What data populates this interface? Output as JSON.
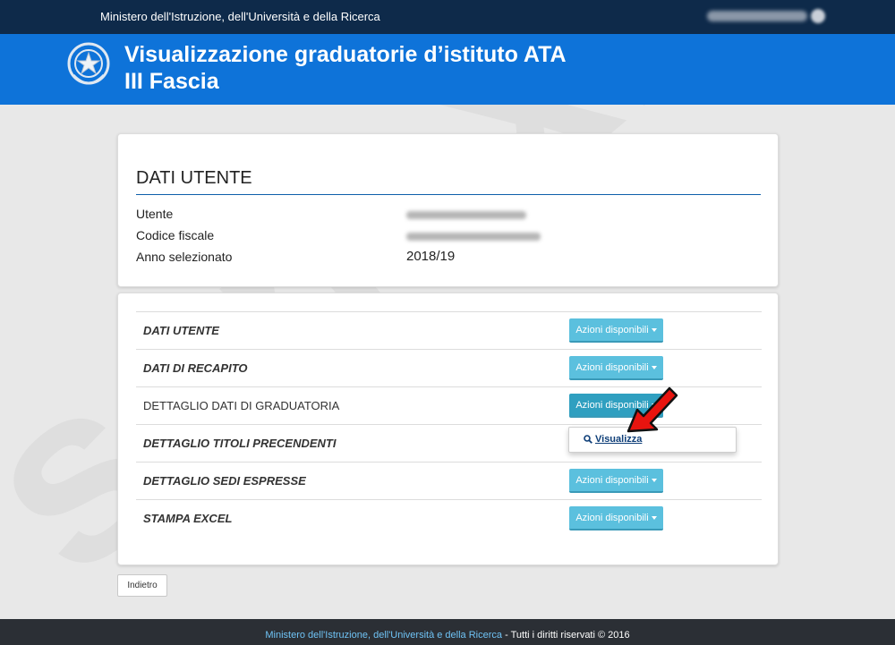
{
  "topbar": {
    "ministry": "Ministero dell'Istruzione, dell'Università e della Ricerca"
  },
  "header": {
    "title_line1": "Visualizzazione graduatorie d’istituto ATA",
    "title_line2": "III Fascia"
  },
  "user_panel": {
    "title": "DATI UTENTE",
    "fields": [
      {
        "label": "Utente"
      },
      {
        "label": "Codice fiscale"
      },
      {
        "label": "Anno selezionato",
        "value": "2018/19"
      }
    ]
  },
  "actions": {
    "button_label": "Azioni disponibili",
    "rows": [
      {
        "label": "DATI UTENTE"
      },
      {
        "label": "DATI DI RECAPITO"
      },
      {
        "label": "DETTAGLIO DATI DI GRADUATORIA"
      },
      {
        "label": "DETTAGLIO TITOLI PRECENDENTI"
      },
      {
        "label": "DETTAGLIO SEDI ESPRESSE"
      },
      {
        "label": "STAMPA EXCEL"
      }
    ],
    "dropdown_item": "Visualizza"
  },
  "back_button": "Indietro",
  "footer": {
    "link": "Ministero dell'Istruzione, dell'Università e della Ricerca",
    "rights": " - Tutti i diritti riservati © 2016"
  },
  "watermark": "senex.it",
  "colors": {
    "topbar": "#0e2a4a",
    "header": "#0e73d9",
    "button": "#5bc0de",
    "arrow": "#e8140f"
  }
}
